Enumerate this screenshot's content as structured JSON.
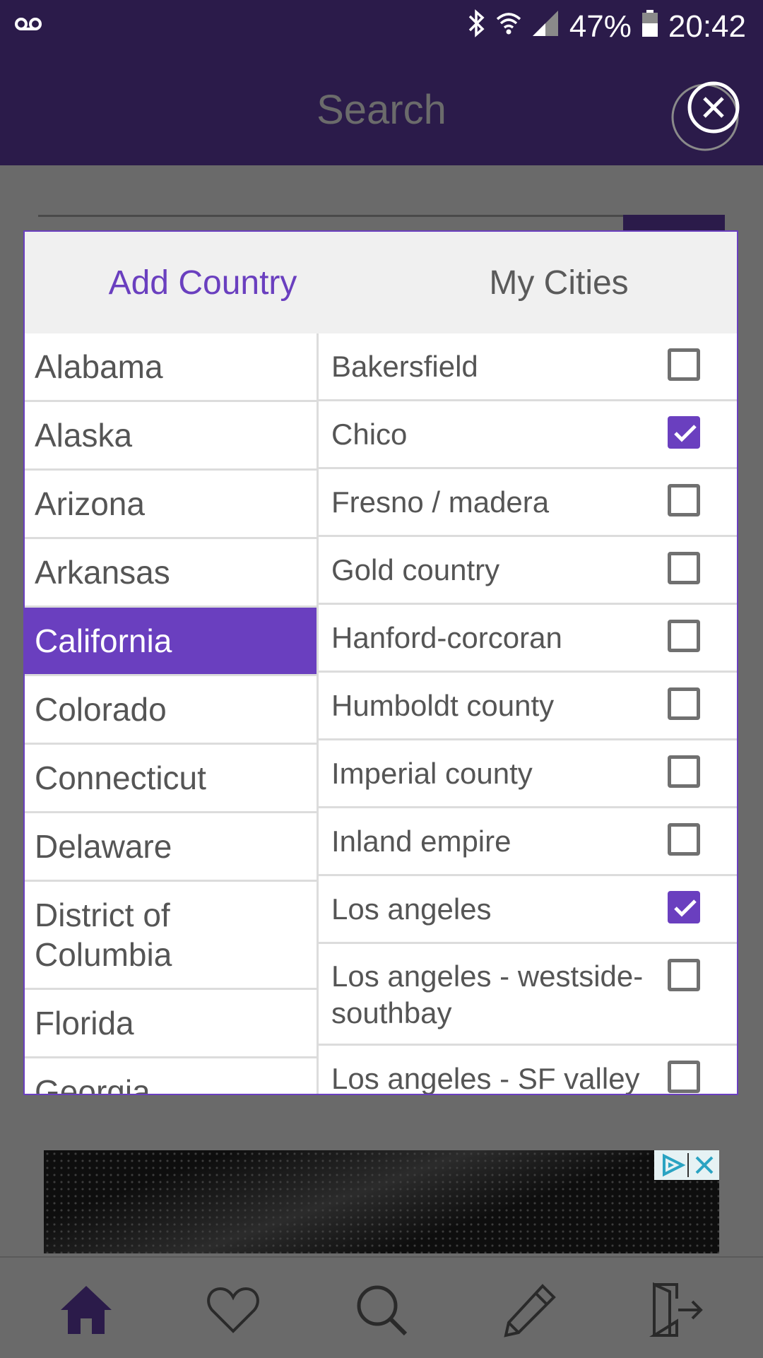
{
  "status_bar": {
    "battery": "47%",
    "time": "20:42",
    "icons": [
      "voicemail-icon",
      "bluetooth-icon",
      "wifi-icon",
      "signal-icon",
      "battery-icon"
    ]
  },
  "header": {
    "title": "Search",
    "close_icon": "close-circle-icon"
  },
  "dialog": {
    "tabs": [
      {
        "label": "Add Country",
        "active": true
      },
      {
        "label": "My Cities",
        "active": false
      }
    ],
    "states": [
      {
        "label": "Alabama",
        "selected": false
      },
      {
        "label": "Alaska",
        "selected": false
      },
      {
        "label": "Arizona",
        "selected": false
      },
      {
        "label": "Arkansas",
        "selected": false
      },
      {
        "label": "California",
        "selected": true
      },
      {
        "label": "Colorado",
        "selected": false
      },
      {
        "label": "Connecticut",
        "selected": false
      },
      {
        "label": "Delaware",
        "selected": false
      },
      {
        "label": "District of Columbia",
        "selected": false
      },
      {
        "label": "Florida",
        "selected": false
      },
      {
        "label": "Georgia",
        "selected": false
      }
    ],
    "cities": [
      {
        "label": "Bakersfield",
        "checked": false
      },
      {
        "label": "Chico",
        "checked": true
      },
      {
        "label": "Fresno / madera",
        "checked": false
      },
      {
        "label": "Gold country",
        "checked": false
      },
      {
        "label": "Hanford-corcoran",
        "checked": false
      },
      {
        "label": "Humboldt county",
        "checked": false
      },
      {
        "label": "Imperial county",
        "checked": false
      },
      {
        "label": "Inland empire",
        "checked": false
      },
      {
        "label": "Los angeles",
        "checked": true
      },
      {
        "label": "Los angeles - westside-southbay",
        "checked": false
      },
      {
        "label": "Los angeles - SF valley",
        "checked": false
      }
    ]
  },
  "bottom_nav": {
    "items": [
      "home-icon",
      "heart-icon",
      "search-icon",
      "pencil-icon",
      "logout-icon"
    ],
    "active": "home-icon"
  },
  "colors": {
    "primary": "#6a3fbf",
    "header_bg": "#2b1b4a",
    "overlay": "#6a6a6a"
  }
}
